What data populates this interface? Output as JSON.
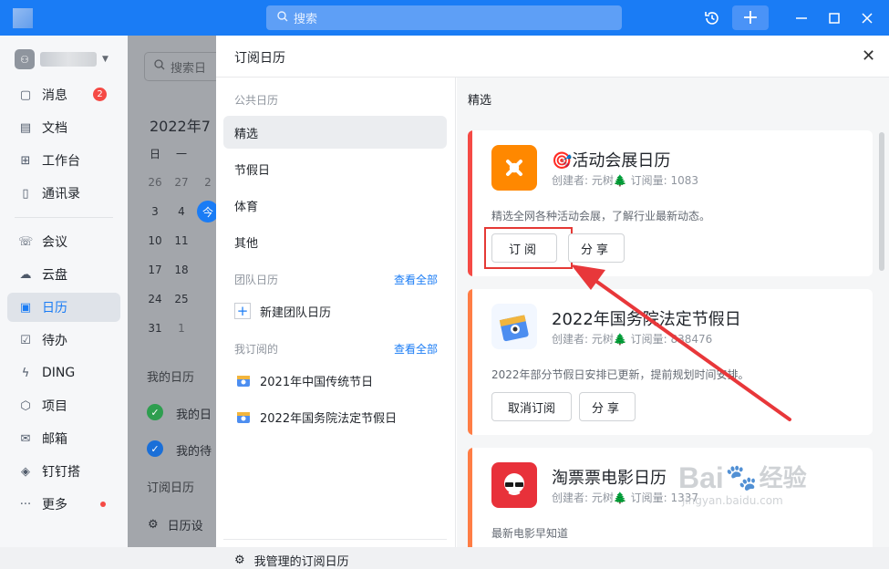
{
  "titlebar": {
    "search_placeholder": "搜索",
    "icons": [
      "history-icon",
      "add-icon",
      "minimize-icon",
      "maximize-icon",
      "close-icon"
    ],
    "color": "#1a7cf5"
  },
  "sidebar": {
    "items": [
      {
        "label": "消息",
        "icon": "message-icon",
        "badge": "2"
      },
      {
        "label": "文档",
        "icon": "document-icon"
      },
      {
        "label": "工作台",
        "icon": "workbench-icon"
      },
      {
        "label": "通讯录",
        "icon": "contacts-icon"
      },
      {
        "label": "会议",
        "icon": "phone-icon"
      },
      {
        "label": "云盘",
        "icon": "cloud-icon"
      },
      {
        "label": "日历",
        "icon": "calendar-icon",
        "active": true
      },
      {
        "label": "待办",
        "icon": "todo-icon"
      },
      {
        "label": "DING",
        "icon": "lightning-icon"
      },
      {
        "label": "项目",
        "icon": "project-icon"
      },
      {
        "label": "邮箱",
        "icon": "mail-icon"
      },
      {
        "label": "钉钉搭",
        "icon": "builder-icon"
      },
      {
        "label": "更多",
        "icon": "more-icon",
        "dot": true
      }
    ]
  },
  "calendar_pane": {
    "search_placeholder": "搜索日",
    "month": "2022年7",
    "weekdays": [
      "日",
      "一"
    ],
    "rows": [
      [
        "26",
        "27"
      ],
      [
        "3",
        "4"
      ],
      [
        "10",
        "11"
      ],
      [
        "17",
        "18"
      ],
      [
        "24",
        "25"
      ],
      [
        "31",
        "1"
      ]
    ],
    "today": "今",
    "extra_28": "2",
    "my_calendars_title": "我的日历",
    "my_calendars": [
      "我的日",
      "我的待"
    ],
    "subscribed_title": "订阅日历",
    "settings_label": "日历设"
  },
  "dialog": {
    "title": "订阅日历",
    "public_label": "公共日历",
    "public_items": [
      "精选",
      "节假日",
      "体育",
      "其他"
    ],
    "team_label": "团队日历",
    "see_all": "查看全部",
    "new_team": "新建团队日历",
    "mine_label": "我订阅的",
    "mine_items": [
      "2021年中国传统节日",
      "2022年国务院法定节假日"
    ],
    "manage": "我管理的订阅日历",
    "selected_section": "精选",
    "cards": [
      {
        "title": "🎯活动会展日历",
        "meta": "创建者: 元树🌲   订阅量: 1083",
        "desc": "精选全网各种活动会展，了解行业最新动态。",
        "btn1": "订阅",
        "btn2": "分享",
        "accent": "#f54a45",
        "logo_bg": "#ff8800"
      },
      {
        "title": "2022年国务院法定节假日",
        "meta": "创建者: 元树🌲   订阅量: 838476",
        "desc": "2022年部分节假日安排已更新，提前规划时间安排。",
        "btn1": "取消订阅",
        "btn2": "分享",
        "accent": "#ff7d45",
        "logo_bg": "#f2f7ff"
      },
      {
        "title": "淘票票电影日历",
        "meta": "创建者: 元树🌲   订阅量: 1337",
        "desc": "最新电影早知道",
        "accent": "#ff7d45",
        "logo_bg": "#e8313a"
      }
    ]
  },
  "watermark": {
    "brand": "Bai",
    "brand2": "经验",
    "url": "jingyan.baidu.com"
  }
}
